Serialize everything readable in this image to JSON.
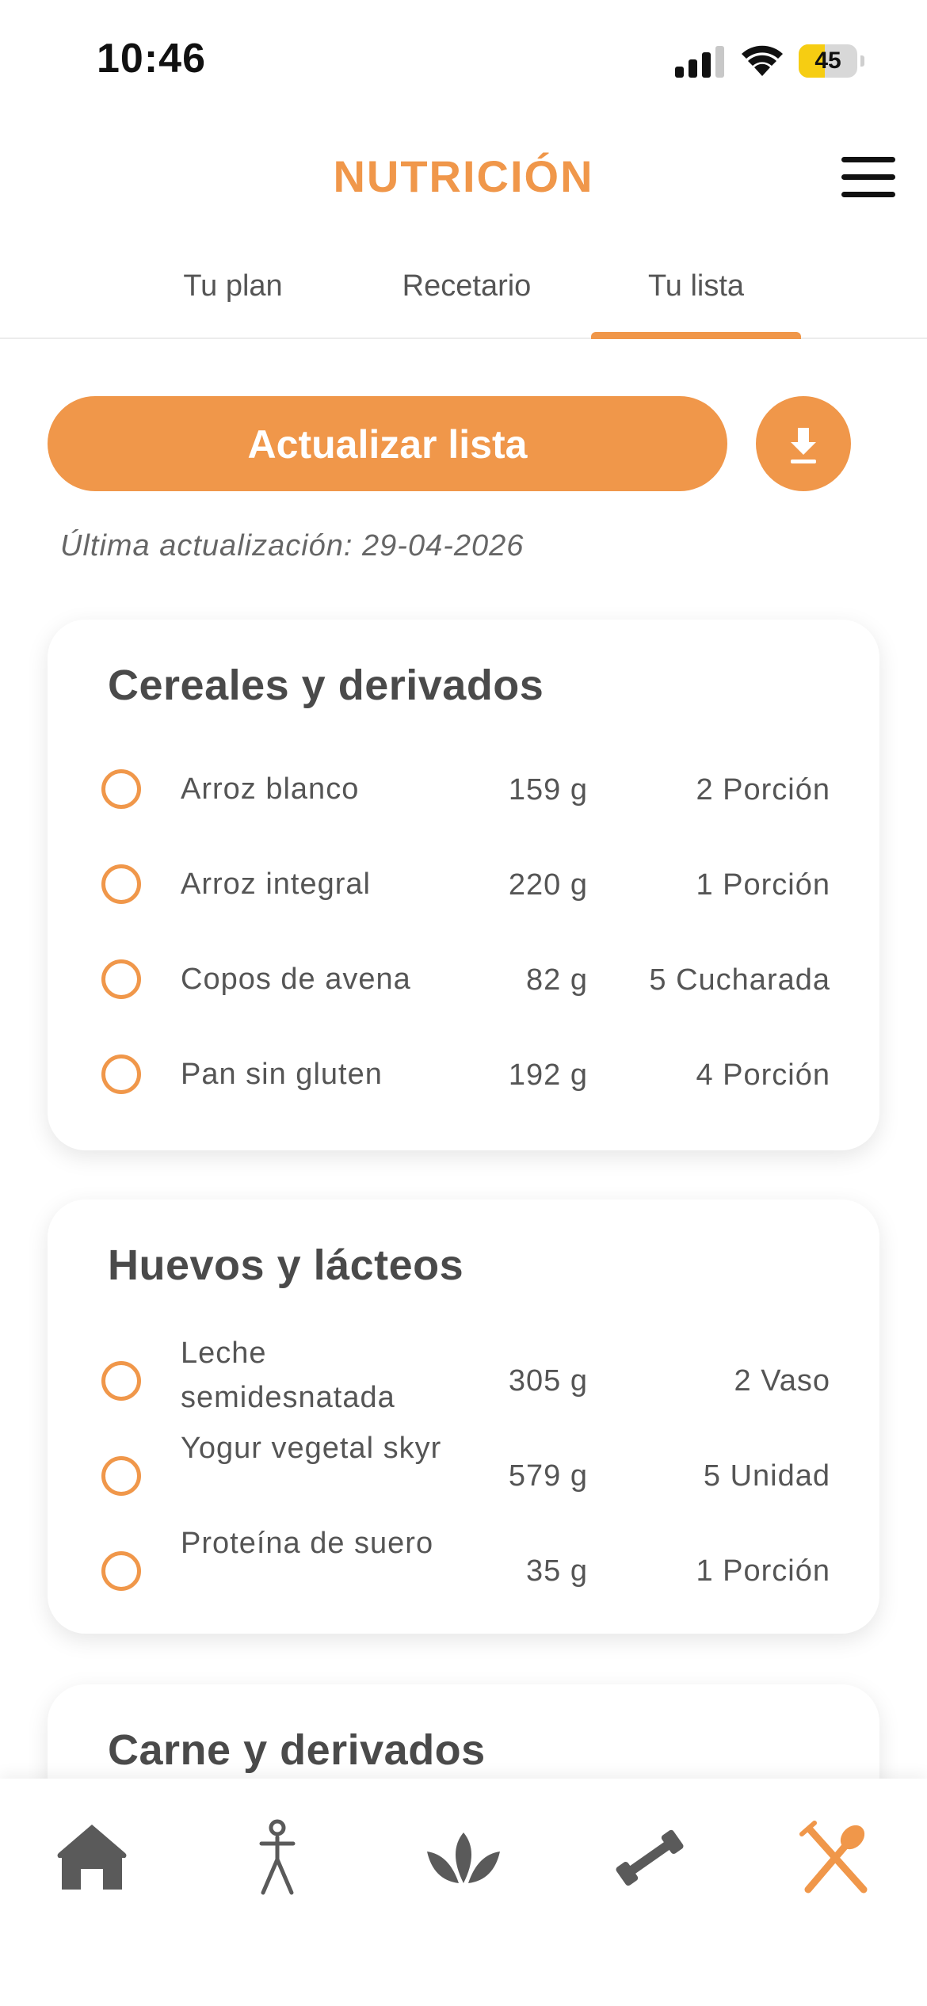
{
  "status_bar": {
    "time": "10:46",
    "battery": "45",
    "battery_level_percent": 45
  },
  "header": {
    "title": "NUTRICIÓN",
    "menu_icon": "hamburger-menu-icon"
  },
  "tabs": [
    {
      "label": "Tu plan",
      "active": false
    },
    {
      "label": "Recetario",
      "active": false
    },
    {
      "label": "Tu lista",
      "active": true
    }
  ],
  "actions": {
    "update_label": "Actualizar lista",
    "download_icon": "download-icon"
  },
  "last_update": "Última actualización: 29-04-2026",
  "categories": [
    {
      "title": "Cereales y derivados",
      "items": [
        {
          "name": "Arroz blanco",
          "weight": "159 g",
          "quantity": "2 Porción"
        },
        {
          "name": "Arroz integral",
          "weight": "220 g",
          "quantity": "1 Porción"
        },
        {
          "name": "Copos de avena",
          "weight": "82 g",
          "quantity": "5 Cucharada"
        },
        {
          "name": "Pan sin gluten",
          "weight": "192 g",
          "quantity": "4 Porción"
        }
      ]
    },
    {
      "title": "Huevos y lácteos",
      "items": [
        {
          "name": "Leche semidesnatada",
          "weight": "305 g",
          "quantity": "2 Vaso"
        },
        {
          "name": "Yogur vegetal skyr",
          "weight": "579 g",
          "quantity": "5 Unidad"
        },
        {
          "name": "Proteína de suero",
          "weight": "35 g",
          "quantity": "1 Porción"
        }
      ]
    },
    {
      "title": "Carne y derivados",
      "items": []
    }
  ],
  "bottom_nav": [
    {
      "icon": "home-icon",
      "active": false
    },
    {
      "icon": "person-stretch-icon",
      "active": false
    },
    {
      "icon": "lotus-icon",
      "active": false
    },
    {
      "icon": "dumbbell-icon",
      "active": false
    },
    {
      "icon": "fork-spoon-icon",
      "active": true
    }
  ],
  "colors": {
    "accent": "#f0974a",
    "text": "#4a4a4a",
    "inactive_icon": "#5a5a5a"
  }
}
